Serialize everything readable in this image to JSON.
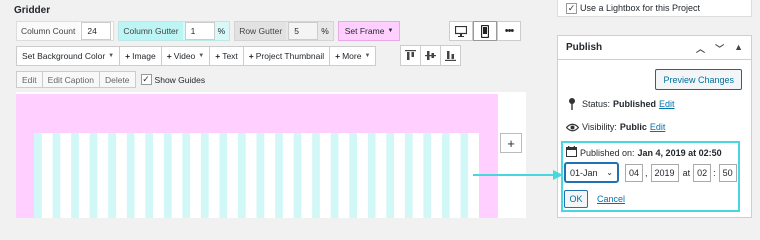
{
  "gridder": {
    "title": "Gridder",
    "column_count_label": "Column Count",
    "column_count_value": "24",
    "column_gutter_label": "Column Gutter",
    "column_gutter_value": "1",
    "column_gutter_unit": "%",
    "row_gutter_label": "Row Gutter",
    "row_gutter_value": "5",
    "row_gutter_unit": "%",
    "set_frame_label": "Set Frame",
    "device_buttons": [
      "desktop-icon",
      "phone-icon",
      "more-icon"
    ],
    "toolbar2": {
      "bg_color": "Set Background Color",
      "image": "Image",
      "video": "Video",
      "text": "Text",
      "thumbnail": "Project Thumbnail",
      "more": "More"
    },
    "toolbar3": {
      "edit": "Edit",
      "edit_caption": "Edit Caption",
      "delete": "Delete",
      "show_guides": "Show Guides"
    },
    "add_label": "+",
    "colors": {
      "frame": "#ffd0ff",
      "column": "#d2f7f7",
      "gutter": "#ffffff",
      "highlight": "#49d6df"
    }
  },
  "sidebar": {
    "lightbox_label": "Use a Lightbox for this Project",
    "publish": {
      "title": "Publish",
      "preview": "Preview Changes",
      "status_label": "Status:",
      "status_value": "Published",
      "status_edit": "Edit",
      "visibility_label": "Visibility:",
      "visibility_value": "Public",
      "visibility_edit": "Edit",
      "published_on_label": "Published on:",
      "published_on_value": "Jan 4, 2019 at 02:50",
      "month": "01-Jan",
      "day": "04",
      "year": "2019",
      "at": "at",
      "hour": "02",
      "minute": "50",
      "ok": "OK",
      "cancel": "Cancel"
    }
  }
}
